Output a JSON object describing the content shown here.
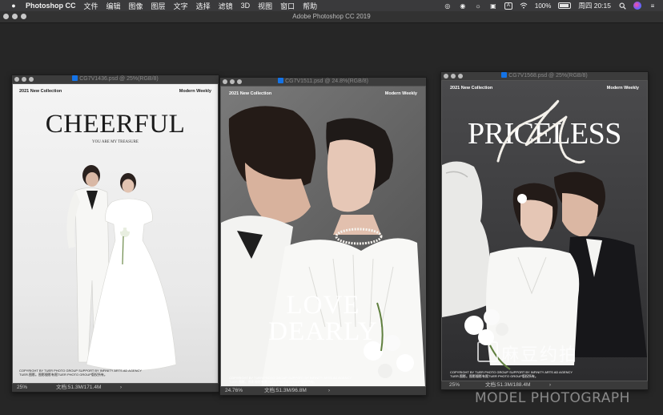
{
  "menubar": {
    "app_name": "Photoshop CC",
    "items": [
      "文件",
      "编辑",
      "图像",
      "图层",
      "文字",
      "选择",
      "滤镜",
      "3D",
      "视图",
      "窗口",
      "帮助"
    ],
    "status_icons": [
      "bullseye-icon",
      "wechat-icon",
      "qq-icon",
      "camera-icon",
      "input-source-a-icon",
      "wifi-icon"
    ],
    "input_letter": "A",
    "battery": "100%",
    "clock": "周四 20:15"
  },
  "app_window": {
    "title": "Adobe Photoshop CC 2019"
  },
  "documents": [
    {
      "title": "CG7V1436.psd @ 25%(RGB/8)",
      "zoom": "25%",
      "doc_size": "文档:51.3M/171.4M",
      "poster": {
        "tag_left": "2021 New Collection",
        "tag_right": "Modern Weekly",
        "headline": "CHEERFUL",
        "subline": "YOU ARE MY TREASURE",
        "copyright_1": "COPYRIGHT BY TUER PHOTO GROUP SUPPORT BY INFINITY ARTS AD AGENCY",
        "copyright_2": "TUER.图影。图影摄影有限TUER PHOTO GROUP版权所有。"
      }
    },
    {
      "title": "CG7V1511.psd @ 24.8%(RGB/8)",
      "zoom": "24.76%",
      "doc_size": "文档:51.3M/96.8M",
      "poster": {
        "tag_left": "2021 New Collection",
        "tag_right": "Modern Weekly",
        "headline_1": "LOVE",
        "headline_2": "DEARLY",
        "copyright_1": "COPYRIGHT BY TUER PHOTO GROUP SUPPORT BY INFINITY ARTS AD AGENCY",
        "copyright_2": "TUER.图影。图影摄影有限TUER PHOTO GROUP版权所有。"
      }
    },
    {
      "title": "CG7V1568.psd @ 25%(RGB/8)",
      "zoom": "25%",
      "doc_size": "文档:51.3M/188.4M",
      "poster": {
        "tag_left": "2021 New Collection",
        "tag_right": "Modern Weekly",
        "headline": "PRICELESS",
        "copyright_1": "COPYRIGHT BY TUER PHOTO GROUP SUPPORT BY INFINITY ARTS AD AGENCY",
        "copyright_2": "TUER.图影。图影摄影有限TUER PHOTO GROUP版权所有。"
      }
    }
  ],
  "watermark": {
    "logo": "麻豆约拍",
    "text": "MODEL PHOTOGRAPH"
  }
}
